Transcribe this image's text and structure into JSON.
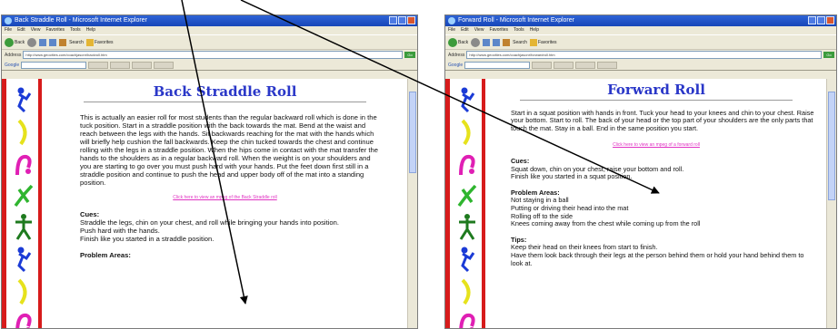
{
  "left": {
    "window_title": "Back Straddle Roll - Microsoft Internet Explorer",
    "menu": [
      "File",
      "Edit",
      "View",
      "Favorites",
      "Tools",
      "Help"
    ],
    "toolbar": {
      "back": "Back",
      "search": "Search",
      "favorites": "Favorites"
    },
    "address": {
      "label": "Address",
      "url": "http://www.geocities.com/coachjasonr/backroll.htm",
      "go": "Go"
    },
    "google_label": "Google",
    "page_title": "Back Straddle Roll",
    "description": "This is actually an easier roll for most students than the regular backward roll which is done in the tuck position. Start in a straddle position with the back towards the mat. Bend at the waist and reach between the legs with the hands. Sit backwards reaching for the mat with the hands which will briefly help cushion the fall backwards. Keep the chin tucked towards the chest and continue rolling with the legs in a straddle position. When the hips come in contact with the mat transfer the hands to the shoulders as in a regular backward roll. When the weight is on your shoulders and you are starting to go over you must push hard with your hands. Put the feet down first still in a straddle position and continue to push the head and upper body off of the mat into a standing position.",
    "link_text": "Click here to view an mpeg of the Back Straddle roll",
    "cues_heading": "Cues:",
    "cues": [
      "Straddle the legs, chin on your chest, and roll while bringing your hands into position.",
      "Push hard with the hands.",
      "Finish like you started in a straddle position."
    ],
    "problems_heading": "Problem Areas:"
  },
  "right": {
    "window_title": "Forward Roll - Microsoft Internet Explorer",
    "menu": [
      "File",
      "Edit",
      "View",
      "Favorites",
      "Tools",
      "Help"
    ],
    "toolbar": {
      "back": "Back",
      "search": "Search",
      "favorites": "Favorites"
    },
    "address": {
      "label": "Address",
      "url": "http://www.geocities.com/coachjasonr/forwardroll.htm",
      "go": "Go"
    },
    "google_label": "Google",
    "page_title": "Forward Roll",
    "description": "Start in a squat position with hands in front. Tuck your head to your knees and chin to your chest. Raise your bottom. Start to roll. The back of your head or the top part of your shoulders are the only parts that touch the mat. Stay in a ball. End in the same position you start.",
    "link_text": "Click here to view an mpeg of a forward roll",
    "cues_heading": "Cues:",
    "cues": [
      "Squat down, chin on your chest, raise your bottom and roll.",
      "Finish like you started in a squat position."
    ],
    "problems_heading": "Problem Areas:",
    "problems": [
      "Not staying in a ball",
      "Putting or driving their head into the mat",
      "Rolling off to the side",
      "Knees coming away from the chest while coming up from the roll"
    ],
    "tips_heading": "Tips:",
    "tips": [
      "Keep their head on their knees from start to finish.",
      "Have them look back through their legs at the person behind them or hold your hand behind them to look at."
    ]
  },
  "colors": {
    "title": "#2a37c8",
    "link": "#e033c2",
    "border": "#d71b1b",
    "titlebar": "#1f4fc4"
  }
}
